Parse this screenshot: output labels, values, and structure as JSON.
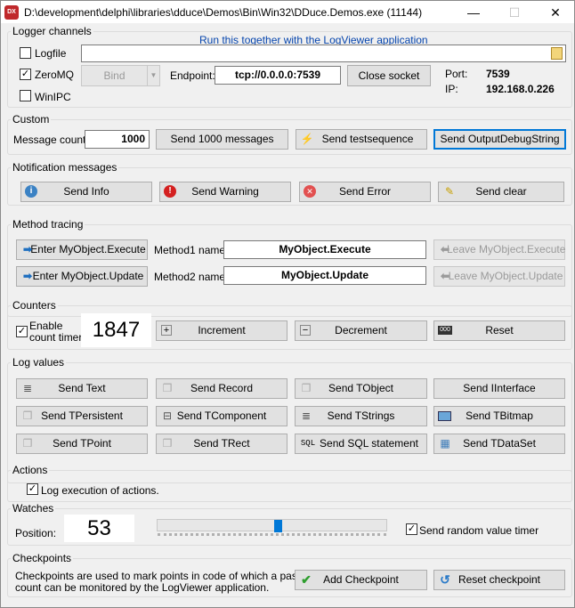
{
  "window": {
    "title": "D:\\development\\delphi\\libraries\\dduce\\Demos\\Bin\\Win32\\DDuce.Demos.exe (11144)",
    "icon_text": "DX",
    "minimize": "—",
    "maximize": "☐",
    "close": "✕"
  },
  "logger": {
    "title": "Logger channels",
    "link": "Run this together with the LogViewer application",
    "logfile_label": "Logfile",
    "logfile_checked": false,
    "logfile_value": "",
    "zeromq_label": "ZeroMQ",
    "zeromq_checked": true,
    "winipc_label": "WinIPC",
    "winipc_checked": false,
    "bind_label": "Bind",
    "endpoint_label": "Endpoint:",
    "endpoint_value": "tcp://0.0.0.0:7539",
    "close_socket": "Close socket",
    "port_label": "Port:",
    "port_value": "7539",
    "ip_label": "IP:",
    "ip_value": "192.168.0.226"
  },
  "custom": {
    "title": "Custom",
    "message_count_label": "Message count:",
    "message_count_value": "1000",
    "send_messages": "Send 1000 messages",
    "send_testsequence": "Send testsequence",
    "send_outputdebugstring": "Send OutputDebugString"
  },
  "notifications": {
    "title": "Notification messages",
    "send_info": "Send Info",
    "send_warning": "Send Warning",
    "send_error": "Send Error",
    "send_clear": "Send clear"
  },
  "tracing": {
    "title": "Method tracing",
    "enter1": "Enter MyObject.Execute",
    "enter2": "Enter MyObject.Update",
    "method1_label": "Method1 name:",
    "method1_value": "MyObject.Execute",
    "method2_label": "Method2 name:",
    "method2_value": "MyObject.Update",
    "leave1": "Leave MyObject.Execute",
    "leave2": "Leave MyObject.Update"
  },
  "counters": {
    "title": "Counters",
    "enable_label_1": "Enable",
    "enable_label_2": "count timer",
    "enable_checked": true,
    "value": "1847",
    "increment": "Increment",
    "decrement": "Decrement",
    "reset": "Reset"
  },
  "logvalues": {
    "title": "Log values",
    "buttons": [
      "Send Text",
      "Send Record",
      "Send TObject",
      "Send IInterface",
      "Send TPersistent",
      "Send TComponent",
      "Send TStrings",
      "Send TBitmap",
      "Send TPoint",
      "Send TRect",
      "Send SQL statement",
      "Send TDataSet"
    ]
  },
  "actions": {
    "title": "Actions",
    "log_execution_label": "Log execution of actions.",
    "log_execution_checked": true
  },
  "watches": {
    "title": "Watches",
    "position_label": "Position:",
    "position_value": "53",
    "slider_fraction": 0.53,
    "random_timer_label": "Send random value timer",
    "random_timer_checked": true
  },
  "checkpoints": {
    "title": "Checkpoints",
    "description_1": "Checkpoints are used to mark points in code of which a pass",
    "description_2": "count can be monitored by the LogViewer application.",
    "add": "Add Checkpoint",
    "reset": "Reset checkpoint"
  }
}
